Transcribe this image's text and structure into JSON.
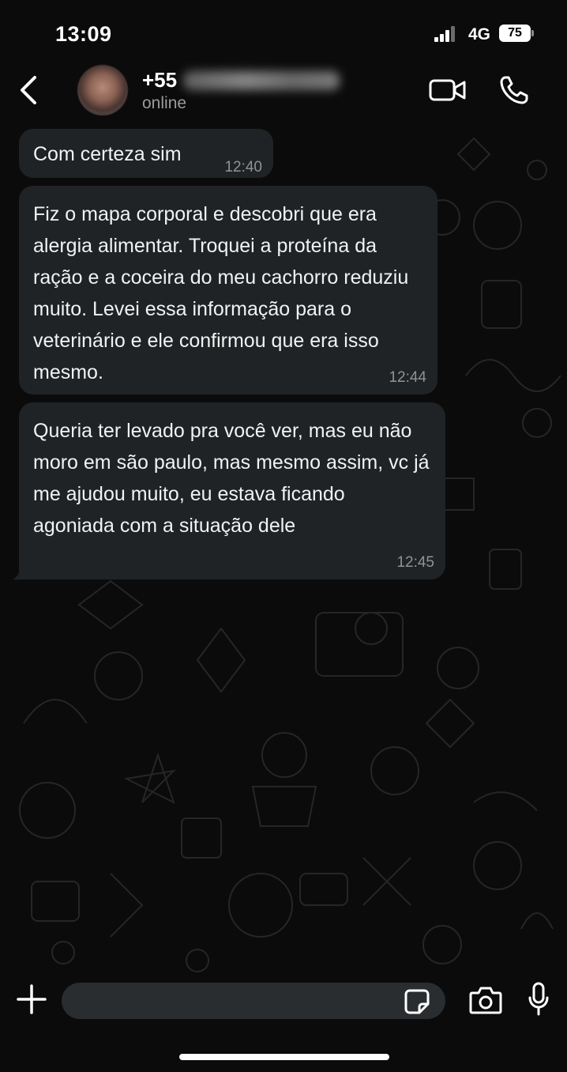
{
  "status_bar": {
    "time": "13:09",
    "network": "4G",
    "battery": "75"
  },
  "header": {
    "contact_name_visible": "+55",
    "contact_status": "online",
    "icons": {
      "back": "chevron-left-icon",
      "video": "video-camera-icon",
      "call": "phone-icon"
    }
  },
  "messages": [
    {
      "text": "Com certeza sim",
      "time": "12:40"
    },
    {
      "text": "Fiz o mapa corporal e descobri que era alergia alimentar. Troquei a proteína da ração e a coceira do meu cachorro reduziu muito. Levei essa informação para o veterinário e ele confirmou que era isso mesmo.",
      "time": "12:44"
    },
    {
      "text": "Queria ter levado pra você ver, mas eu não moro em são paulo, mas mesmo assim, vc já me ajudou muito, eu estava ficando agoniada com a situação dele",
      "time": "12:45"
    }
  ],
  "input_bar": {
    "message_value": "",
    "icons": {
      "plus": "plus-icon",
      "sticker": "sticker-icon",
      "camera": "camera-icon",
      "mic": "microphone-icon"
    }
  },
  "colors": {
    "background": "#0b0b0b",
    "bubble": "#1f2326",
    "timestamp": "#8f9396",
    "secondary_text": "#9b9b9b"
  }
}
